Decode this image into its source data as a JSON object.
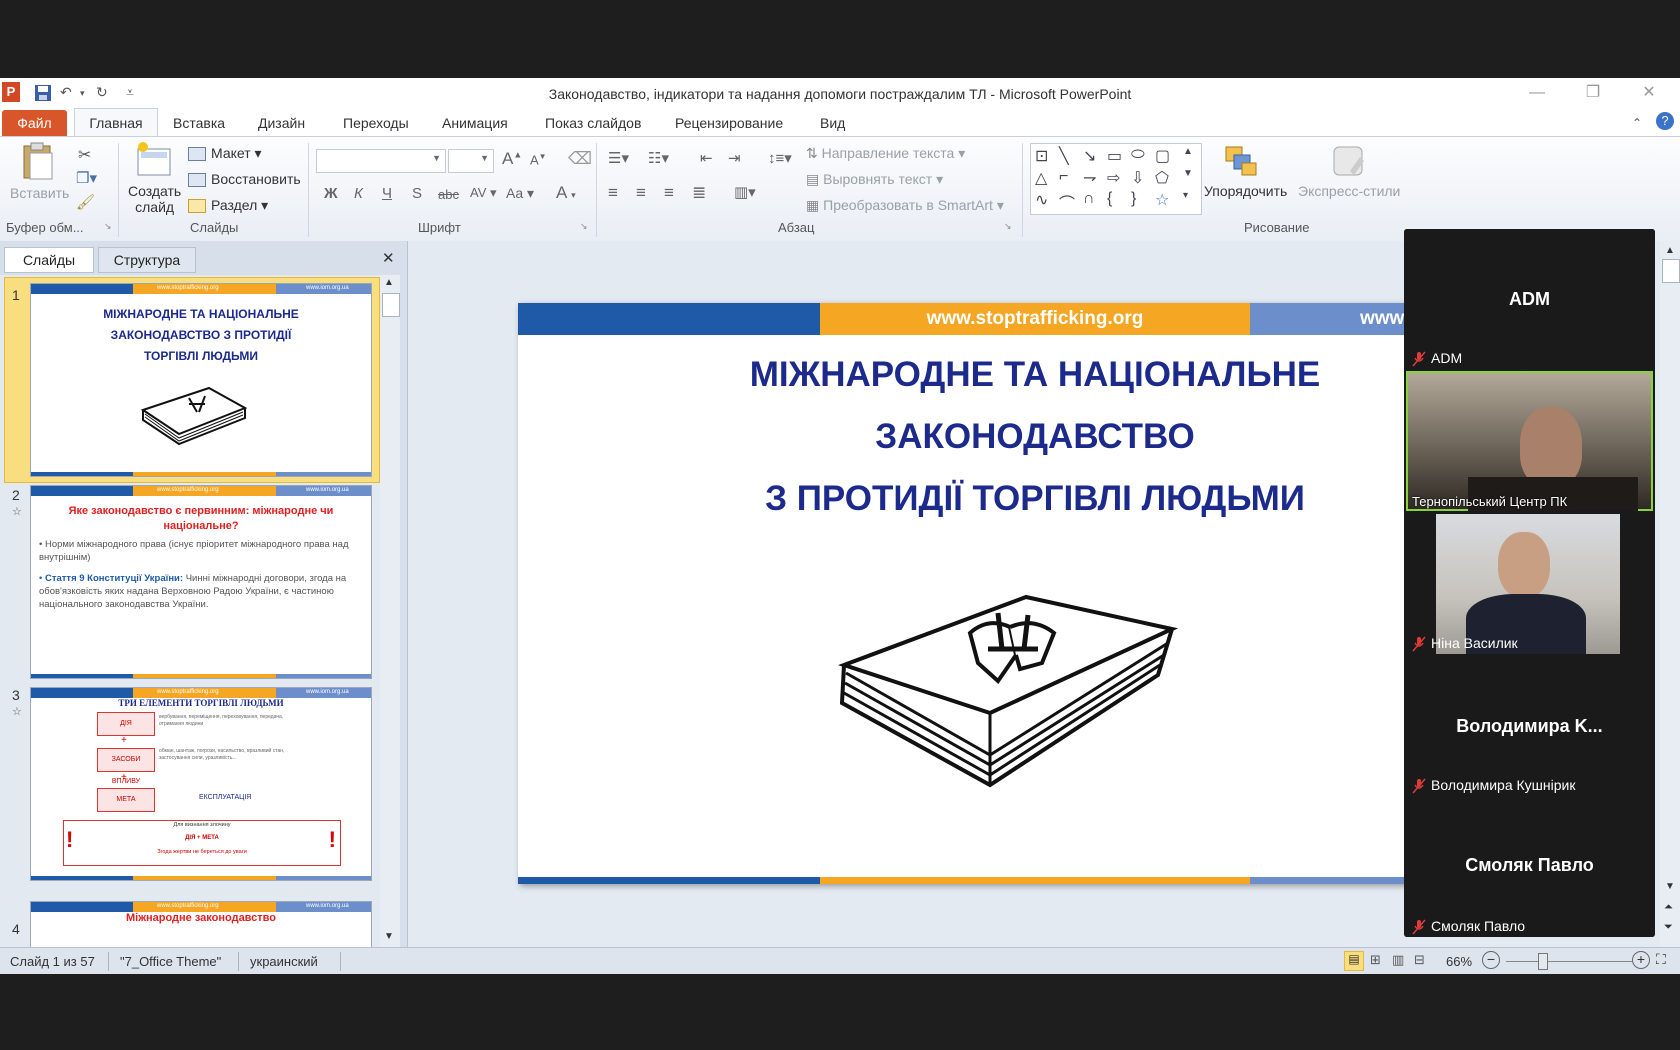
{
  "window": {
    "title": "Законодавство, індикатори   та надання допомоги постраждалим ТЛ  -  Microsoft PowerPoint"
  },
  "ribbon_tabs": [
    "Файл",
    "Главная",
    "Вставка",
    "Дизайн",
    "Переходы",
    "Анимация",
    "Показ слайдов",
    "Рецензирование",
    "Вид"
  ],
  "ribbon": {
    "clipboard": {
      "paste": "Вставить",
      "label": "Буфер обм..."
    },
    "slides": {
      "new_slide_1": "Создать",
      "new_slide_2": "слайд",
      "layout": "Макет",
      "reset": "Восстановить",
      "section": "Раздел",
      "label": "Слайды"
    },
    "font": {
      "label": "Шрифт",
      "bold": "Ж",
      "italic": "К",
      "underline": "Ч",
      "shadow": "S",
      "strike": "abc",
      "spacing": "AV",
      "case": "Aa",
      "grow": "A",
      "shrink": "A",
      "color": "A"
    },
    "paragraph": {
      "label": "Абзац",
      "direction": "Направление текста",
      "align": "Выровнять текст",
      "smartart": "Преобразовать в SmartArt"
    },
    "drawing": {
      "label": "Рисование",
      "arrange": "Упорядочить",
      "quick_styles": "Экспресс-стили"
    }
  },
  "leftpane": {
    "tab_slides": "Слайды",
    "tab_outline": "Структура",
    "slides": [
      {
        "num": "1",
        "url": "www.stoptrafficking.org",
        "url2": "www.iom.org.ua",
        "title": "МІЖНАРОДНЕ  ТА НАЦІОНАЛЬНЕ ЗАКОНОДАВСТВО З ПРОТИДІЇ  ТОРГІВЛІ  ЛЮДЬМИ"
      },
      {
        "num": "2",
        "url": "www.stoptrafficking.org",
        "url2": "www.iom.org.ua",
        "title": "Яке законодавство  є первинним:  міжнародне   чи національне?",
        "bullet1": "Норми міжнародного права (існує пріоритет міжнародного права над внутрішнім)",
        "bullet2_bold": "Стаття 9 Конституції України:",
        "bullet2": " Чинні міжнародні договори, згода на обов'язковість яких надана Верховною Радою України, є частиною національного законодавства  України."
      },
      {
        "num": "3",
        "url": "www.stoptrafficking.org",
        "url2": "www.iom.org.ua",
        "title": "ТРИ ЕЛЕМЕНТИ ТОРГІВЛІ ЛЮДЬМИ",
        "box1": "ДІЯ",
        "box2": "ЗАСОБИ ВПЛИВУ",
        "box3": "МЕТА",
        "plus": "+",
        "exploit": "ЕКСПЛУАТАЦІЯ",
        "text1": "вербування, переміщення, переховування, передача, отримання людини",
        "text2": "обман, шантаж, погрози, насильство, вразливий стан, застосування сили, уразливість...",
        "note": "Для визнання злочину",
        "note2": "ДІЯ + МЕТА",
        "note3": "Згода жертви не береться до уваги",
        "excl": "!"
      },
      {
        "num": "4",
        "url": "www.stoptrafficking.org",
        "url2": "www.iom.org.ua",
        "title": "Міжнародне  законодавство"
      }
    ]
  },
  "slide": {
    "url": "www.stoptrafficking.org",
    "url_right": "www",
    "line1": "МІЖНАРОДНЕ ТА НАЦІОНАЛЬНЕ",
    "line2": "ЗАКОНОДАВСТВО",
    "line3": "З ПРОТИДІЇ ТОРГІВЛІ ЛЮДЬМИ"
  },
  "statusbar": {
    "slide_info": "Слайд 1 из 57",
    "theme": "\"7_Office Theme\"",
    "language": "украинский",
    "zoom": "66%"
  },
  "participants": [
    {
      "display": "ADM",
      "name": "ADM",
      "video": false
    },
    {
      "display": "",
      "name": "Тернопільський Центр ПК",
      "video": true
    },
    {
      "display": "",
      "name": "Ніна Василик",
      "video": true
    },
    {
      "display": "Володимира  K...",
      "name": "Володимира Кушнірик",
      "video": false
    },
    {
      "display": "Смоляк Павло",
      "name": "Смоляк Павло",
      "video": false
    }
  ],
  "colors": {
    "file_tab": "#d9562b",
    "slide_blue": "#1f5aa8",
    "slide_orange": "#f5a623",
    "slide_title": "#1c2a8c",
    "highlight": "#f7d24a"
  }
}
